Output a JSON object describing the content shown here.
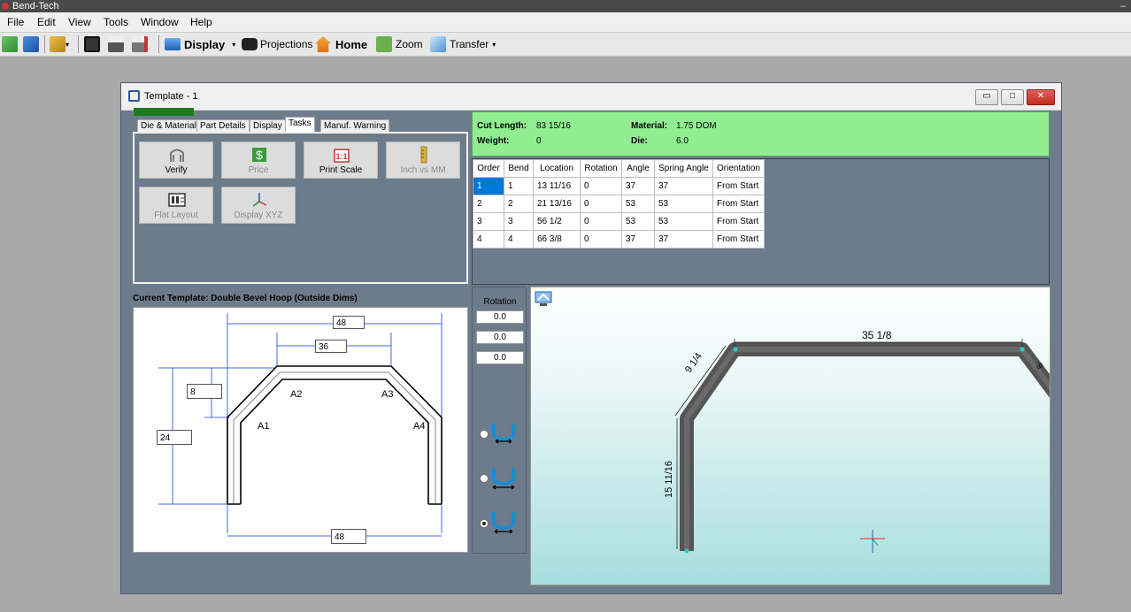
{
  "app": {
    "title": "Bend-Tech",
    "minimize_glyph": "–"
  },
  "menu": [
    "File",
    "Edit",
    "View",
    "Tools",
    "Window",
    "Help"
  ],
  "toolbar": {
    "display": "Display",
    "projections": "Projections",
    "home": "Home",
    "zoom": "Zoom",
    "transfer": "Transfer"
  },
  "window": {
    "title": "Template - 1",
    "progress": 1.0
  },
  "tabs": [
    {
      "label": "Die & Material",
      "active": false
    },
    {
      "label": "Part Details",
      "active": false
    },
    {
      "label": "Display",
      "active": false
    },
    {
      "label": "Tasks",
      "active": true
    },
    {
      "label": "Manuf. Warning",
      "active": false
    }
  ],
  "tasks": [
    {
      "label": "Verify",
      "enabled": true,
      "icon": "verify-icon"
    },
    {
      "label": "Price",
      "enabled": false,
      "icon": "dollar-icon"
    },
    {
      "label": "Print Scale",
      "enabled": true,
      "icon": "print-scale-icon"
    },
    {
      "label": "Inch vs MM",
      "enabled": false,
      "icon": "ruler-icon"
    },
    {
      "label": "Flat Layout",
      "enabled": false,
      "icon": "flat-layout-icon"
    },
    {
      "label": "Display XYZ",
      "enabled": false,
      "icon": "xyz-axes-icon"
    }
  ],
  "info": {
    "cut_length_label": "Cut Length:",
    "cut_length_value": "83 15/16",
    "weight_label": "Weight:",
    "weight_value": "0",
    "material_label": "Material:",
    "material_value": "1.75 DOM",
    "die_label": "Die:",
    "die_value": "6.0",
    "bg_color": "#90ee90"
  },
  "bend_table": {
    "headers": [
      "Order",
      "Bend",
      "Location",
      "Rotation",
      "Angle",
      "Spring Angle",
      "Orientation"
    ],
    "rows": [
      [
        "1",
        "1",
        "13 11/16",
        "0",
        "37",
        "37",
        "From Start"
      ],
      [
        "2",
        "2",
        "21 13/16",
        "0",
        "53",
        "53",
        "From Start"
      ],
      [
        "3",
        "3",
        "56 1/2",
        "0",
        "53",
        "53",
        "From Start"
      ],
      [
        "4",
        "4",
        "66 3/8",
        "0",
        "37",
        "37",
        "From Start"
      ]
    ],
    "selected_row": 0
  },
  "template": {
    "title": "Current Template: Double Bevel Hoop (Outside Dims)",
    "dims": {
      "top_outer": "48",
      "top_inner": "36",
      "bevel_height": "8",
      "side_height": "24",
      "bottom": "48"
    },
    "bend_labels": [
      "A1",
      "A2",
      "A3",
      "A4"
    ]
  },
  "rotation": {
    "label": "Rotation",
    "values": [
      "0.0",
      "0.0",
      "0.0"
    ],
    "die_options": [
      false,
      false,
      true
    ]
  },
  "view3d": {
    "dims": {
      "top": "35 1/8",
      "bevel": "9 1/4",
      "side": "15 11/16",
      "right_cut": "9"
    }
  }
}
